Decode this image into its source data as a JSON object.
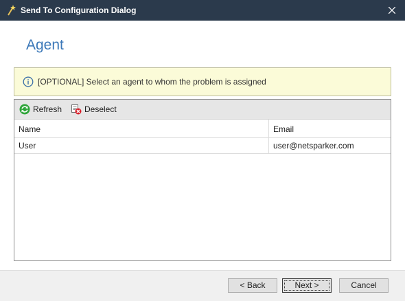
{
  "window": {
    "title": "Send To Configuration Dialog",
    "titlebar_color": "#2b3a4c"
  },
  "page": {
    "heading": "Agent",
    "heading_color": "#3c78b8"
  },
  "info": {
    "icon": "info-icon",
    "text": "[OPTIONAL] Select an agent to whom the problem is assigned",
    "background": "#fbfbd8"
  },
  "toolbar": {
    "refresh_label": "Refresh",
    "refresh_icon": "refresh-icon",
    "deselect_label": "Deselect",
    "deselect_icon": "deselect-icon"
  },
  "table": {
    "columns": [
      "Name",
      "Email"
    ],
    "rows": [
      {
        "name": "User",
        "email": "user@netsparker.com"
      }
    ]
  },
  "footer": {
    "back_label": "< Back",
    "next_label": "Next >",
    "cancel_label": "Cancel"
  }
}
